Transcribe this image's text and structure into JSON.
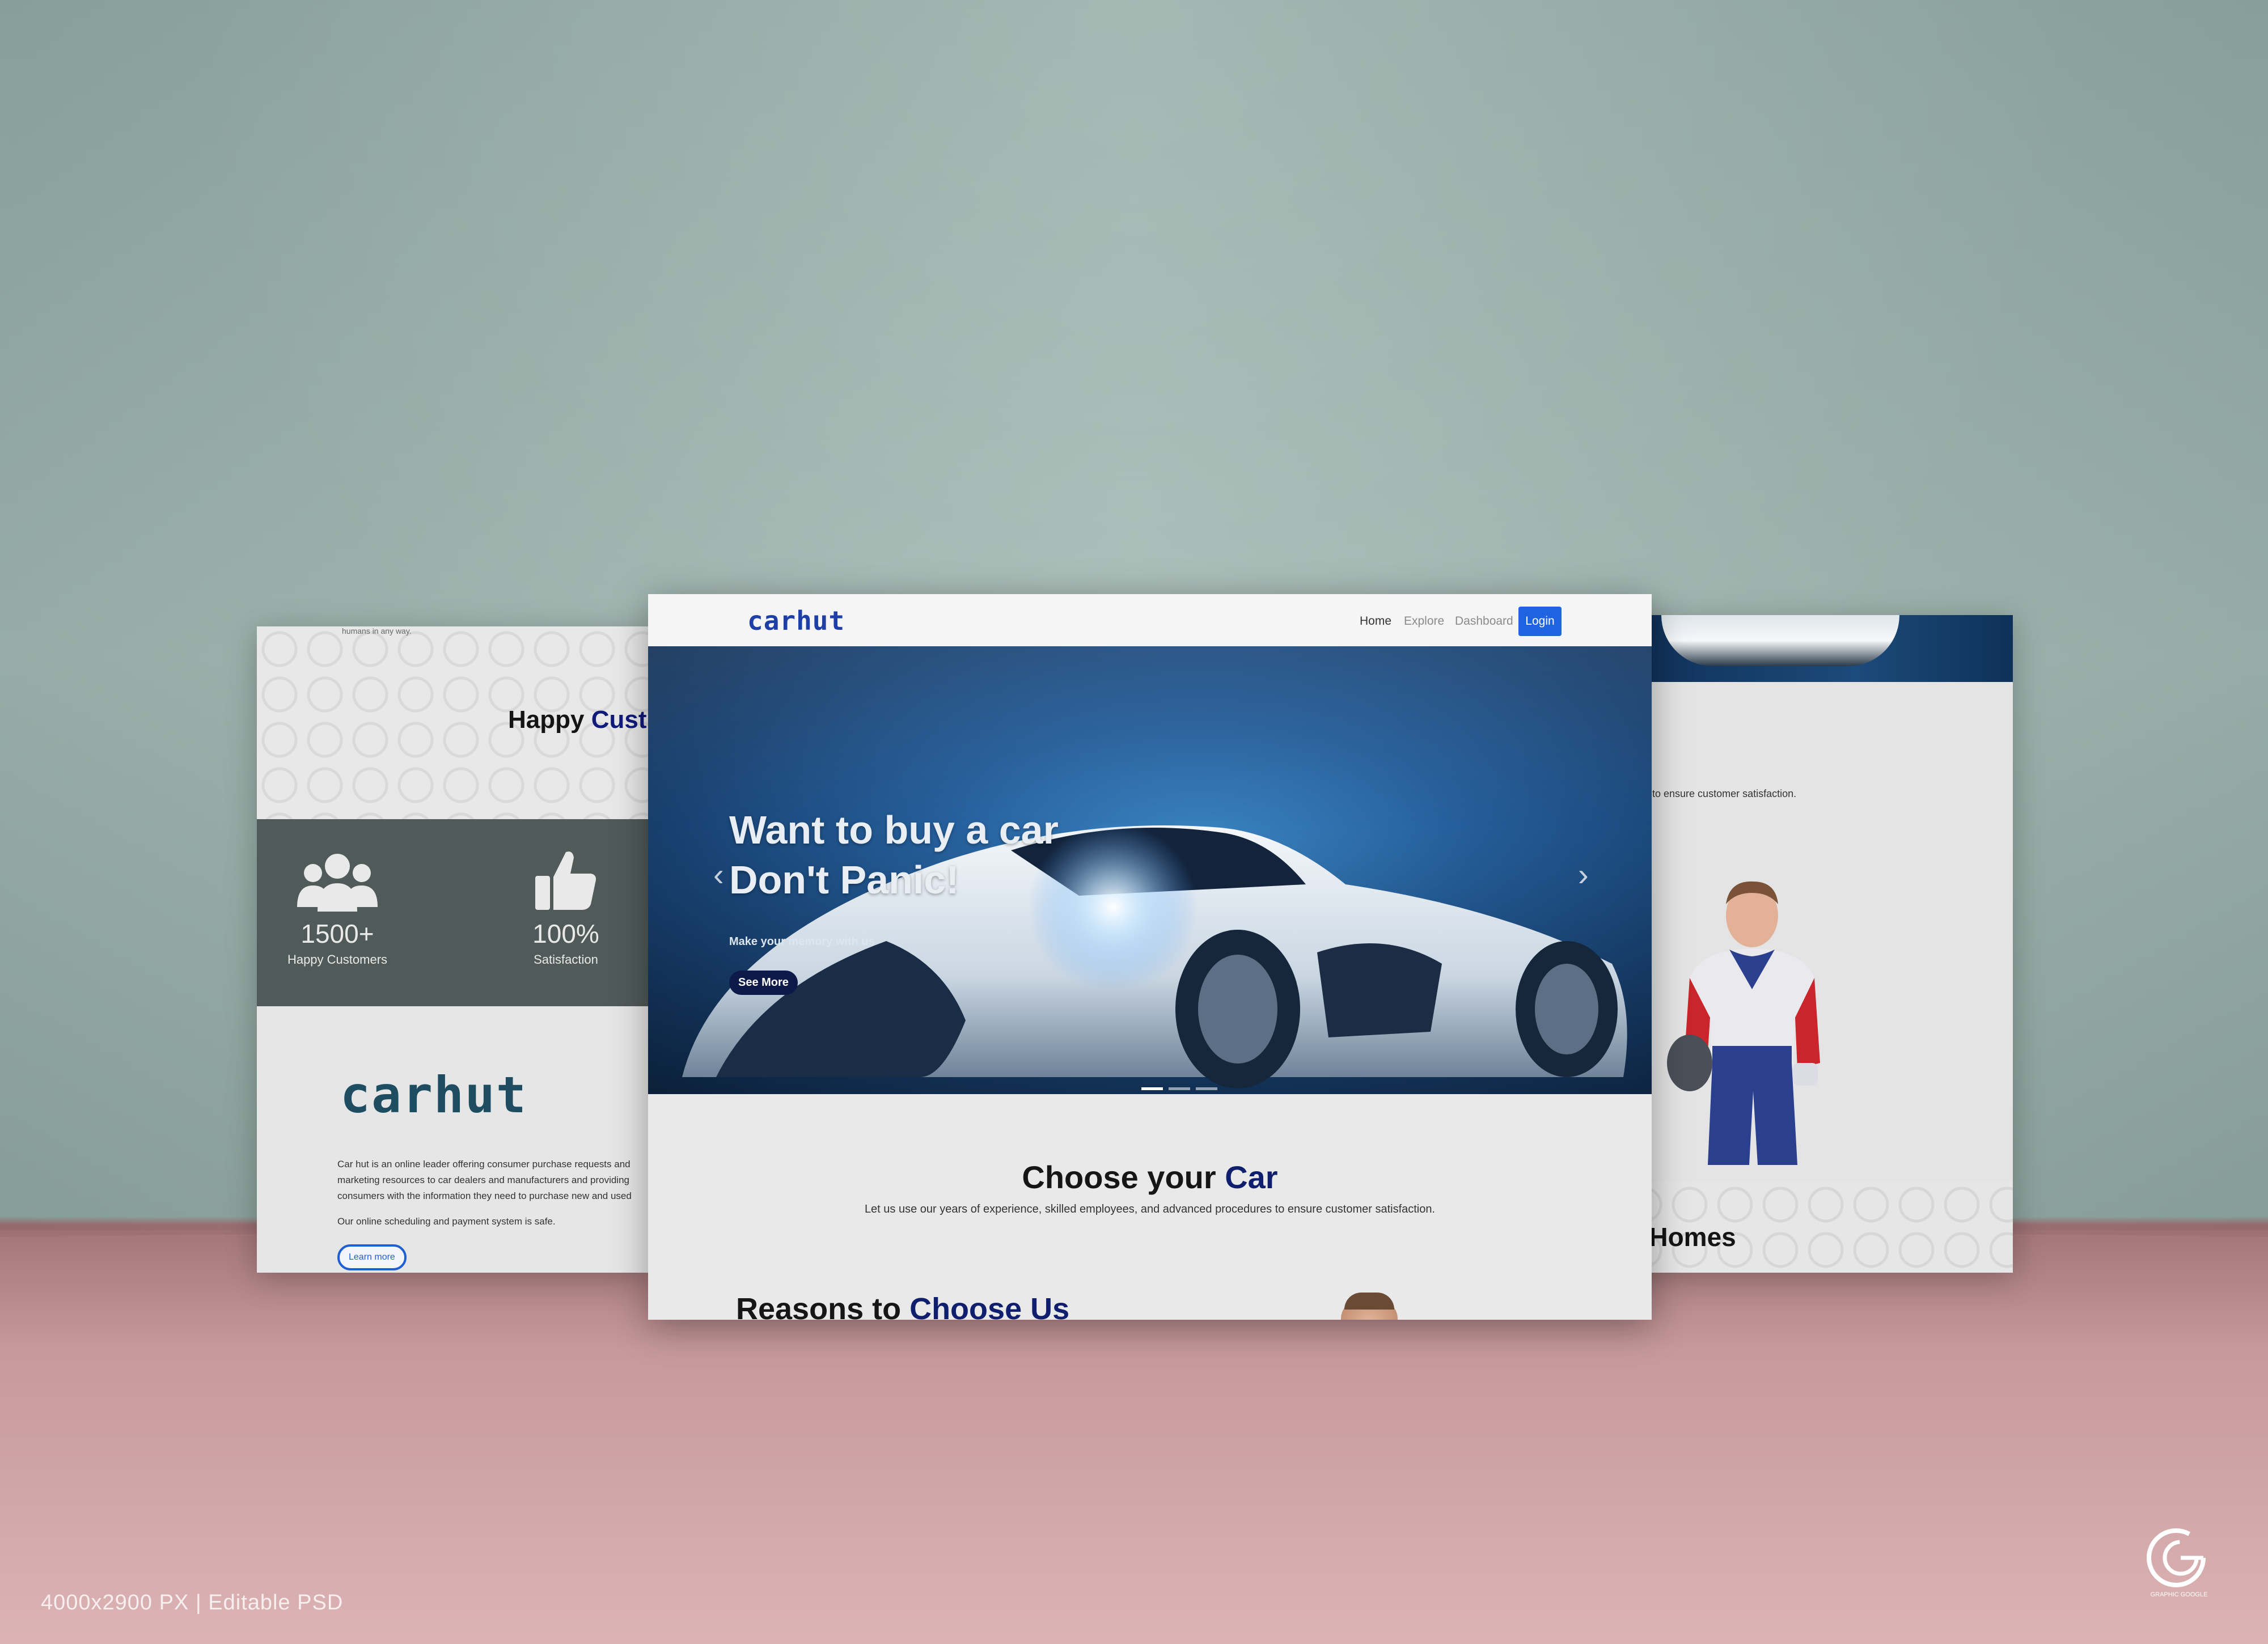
{
  "mockup": {
    "footer_label": "4000x2900 PX   |   Editable PSD",
    "logo_text": "GRAPHIC GOOGLE"
  },
  "left_page": {
    "top_snippet": "humans in any way.",
    "heading_plain": "Happy ",
    "heading_accent": "Cust",
    "stats": [
      {
        "icon": "users-icon",
        "value": "1500+",
        "label": "Happy Customers"
      },
      {
        "icon": "thumbs-up-icon",
        "value": "100%",
        "label": "Satisfaction"
      }
    ],
    "logo": "carhut",
    "about_text": "Car hut is an online leader offering consumer purchase requests and marketing resources to car dealers and manufacturers and providing consumers with the information they need to purchase new and used",
    "security_text": "Our online scheduling and payment system is safe.",
    "learn_more": "Learn more"
  },
  "center_page": {
    "brand": "carhut",
    "nav": {
      "home": "Home",
      "explore": "Explore",
      "dashboard": "Dashboard",
      "login": "Login"
    },
    "hero": {
      "title_line1": "Want to buy a car",
      "title_line2": "Don't Panic!",
      "subtitle": "Make your memory with us",
      "cta": "See More",
      "prev_arrow": "‹",
      "next_arrow": "›"
    },
    "choose": {
      "title_plain": "Choose your ",
      "title_accent": "Car",
      "subtitle": "Let us use our years of experience, skilled employees, and advanced procedures to ensure customer satisfaction."
    },
    "reasons": {
      "title_plain": "Reasons to ",
      "title_accent": "Choose Us"
    }
  },
  "right_page": {
    "text": "s to ensure customer satisfaction.",
    "heading": "y Homes"
  },
  "colors": {
    "brand_blue": "#1f3fa8",
    "accent_navy": "#0f1f6e",
    "login_blue": "#1f63e0",
    "stats_band": "#505a58"
  }
}
